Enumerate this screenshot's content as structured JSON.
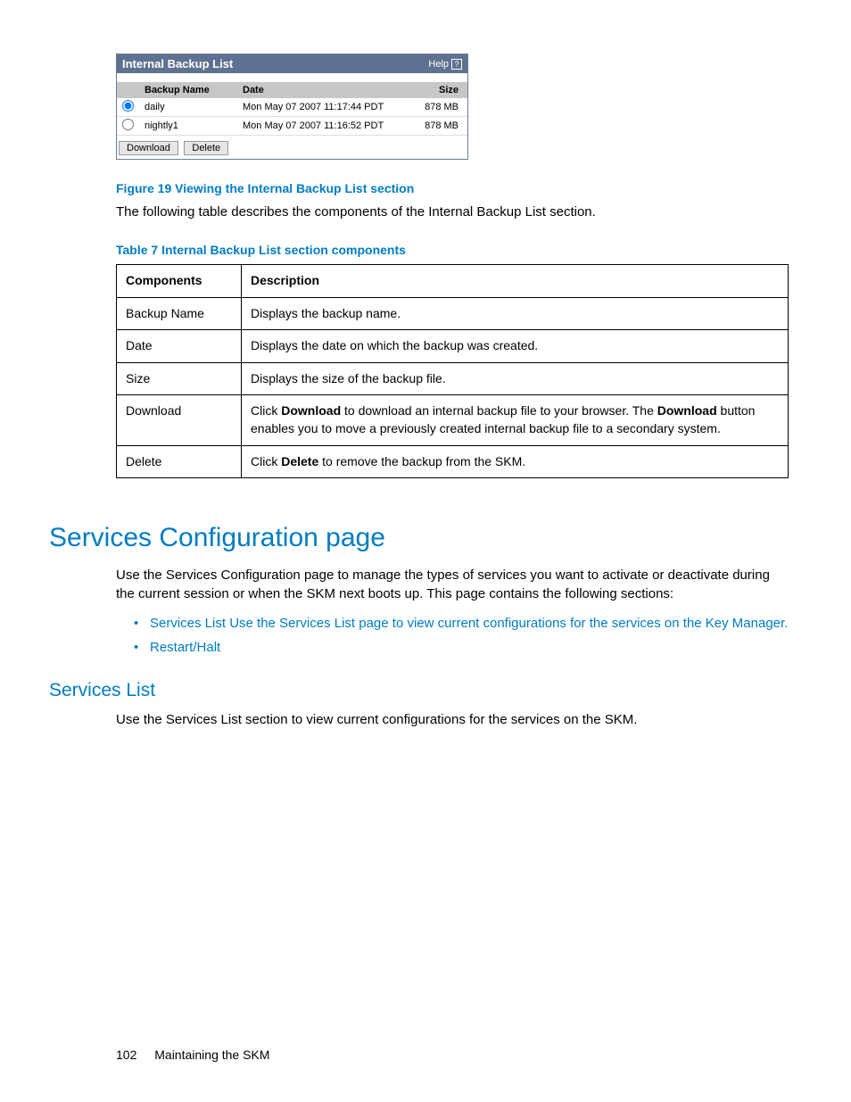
{
  "widget": {
    "title": "Internal Backup List",
    "help_label": "Help",
    "headers": {
      "name": "Backup Name",
      "date": "Date",
      "size": "Size"
    },
    "rows": [
      {
        "name": "daily",
        "date": "Mon May 07 2007 11:17:44 PDT",
        "size": "878 MB",
        "selected": true
      },
      {
        "name": "nightly1",
        "date": "Mon May 07 2007 11:16:52 PDT",
        "size": "878 MB",
        "selected": false
      }
    ],
    "buttons": {
      "download": "Download",
      "delete": "Delete"
    }
  },
  "figure_caption": "Figure 19 Viewing the Internal Backup List section",
  "intro_text": "The following table describes the components of the Internal Backup List section.",
  "table_caption": "Table 7 Internal Backup List section components",
  "components_table": {
    "head": {
      "components": "Components",
      "description": "Description"
    },
    "rows": [
      {
        "c": "Backup Name",
        "d": "Displays the backup name."
      },
      {
        "c": "Date",
        "d": "Displays the date on which the backup was created."
      },
      {
        "c": "Size",
        "d": "Displays the size of the backup file."
      },
      {
        "c": "Download",
        "d_pre": "Click ",
        "d_b1": "Download",
        "d_mid": " to download an internal backup file to your browser. The ",
        "d_b2": "Download",
        "d_post": " button enables you to move a previously created internal backup file to a secondary system."
      },
      {
        "c": "Delete",
        "d_pre": "Click ",
        "d_b1": "Delete",
        "d_post": " to remove the backup from the SKM."
      }
    ]
  },
  "h1": "Services Configuration page",
  "services_intro": "Use the Services Configuration page to manage the types of services you want to activate or deactivate during the current session or when the SKM next boots up. This page contains the following sections:",
  "links": [
    "Services List Use the Services List page to view current configurations for the services on the Key Manager.",
    "Restart/Halt"
  ],
  "h2": "Services List",
  "services_list_text": "Use the Services List section to view current configurations for the services on the SKM.",
  "footer": {
    "page": "102",
    "chapter": "Maintaining the SKM"
  }
}
